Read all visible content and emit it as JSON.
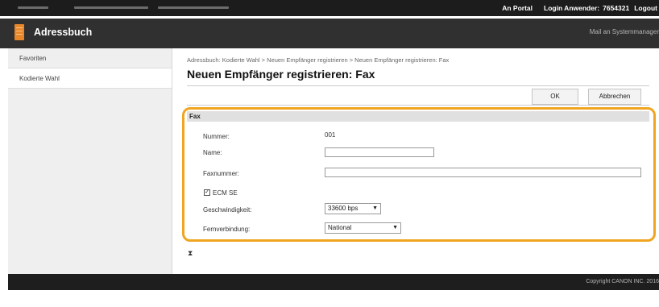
{
  "topbar": {
    "portal_link": "An Portal",
    "login_label": "Login Anwender:",
    "login_user": "7654321",
    "logout_link": "Logout"
  },
  "titlebar": {
    "app_icon": "address-book-icon",
    "title": "Adressbuch",
    "mail_admin": "Mail an Systemmanager"
  },
  "sidebar": {
    "items": [
      {
        "label": "Favoriten"
      },
      {
        "label": "Kodierte Wahl"
      }
    ],
    "active_index": 1
  },
  "main": {
    "breadcrumb": "Adressbuch: Kodierte Wahl > Neuen Empfänger registrieren > Neuen Empfänger registrieren: Fax",
    "title": "Neuen Empfänger registrieren: Fax",
    "ok_label": "OK",
    "cancel_label": "Abbrechen"
  },
  "fax": {
    "section_title": "Fax",
    "nummer_label": "Nummer:",
    "nummer_value": "001",
    "name_label": "Name:",
    "name_value": "",
    "faxnummer_label": "Faxnummer:",
    "faxnummer_value": "",
    "ecm_label": "ECM SE",
    "ecm_checked": true,
    "speed_label": "Geschwindigkeit:",
    "speed_value": "33600 bps",
    "remote_label": "Fernverbindung:",
    "remote_value": "National"
  },
  "page_top_icon": "scroll-to-top-icon",
  "footer": {
    "copyright": "Copyright CANON INC. 2016"
  },
  "colors": {
    "highlight": "#f0a520",
    "accent_icon": "#e8862a",
    "header_dark": "#303030",
    "topbar": "#1c1c1c"
  }
}
